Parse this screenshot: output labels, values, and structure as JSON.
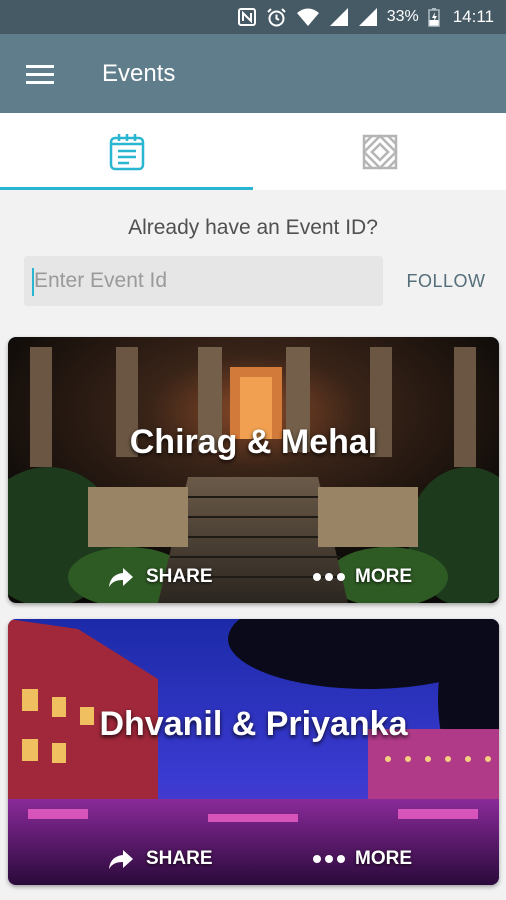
{
  "status_bar": {
    "battery": "33%",
    "time": "14:11",
    "icons": [
      "nfc-icon",
      "alarm-icon",
      "wifi-icon",
      "signal-icon",
      "signal-icon",
      "battery-charging-icon"
    ]
  },
  "app_bar": {
    "title": "Events",
    "menu_icon": "hamburger-menu-icon"
  },
  "tabs": [
    {
      "icon": "calendar-icon",
      "active": true
    },
    {
      "icon": "logo-pattern-icon",
      "active": false
    }
  ],
  "follow": {
    "prompt": "Already have an Event ID?",
    "placeholder": "Enter Event Id",
    "value": "",
    "button_label": "FOLLOW"
  },
  "events": [
    {
      "title": "Chirag & Mehal",
      "share_label": "SHARE",
      "more_label": "MORE"
    },
    {
      "title": "Dhvanil & Priyanka",
      "share_label": "SHARE",
      "more_label": "MORE"
    }
  ],
  "colors": {
    "status_bar": "#455a64",
    "app_bar": "#5f7d8b",
    "accent": "#29b6d1"
  }
}
